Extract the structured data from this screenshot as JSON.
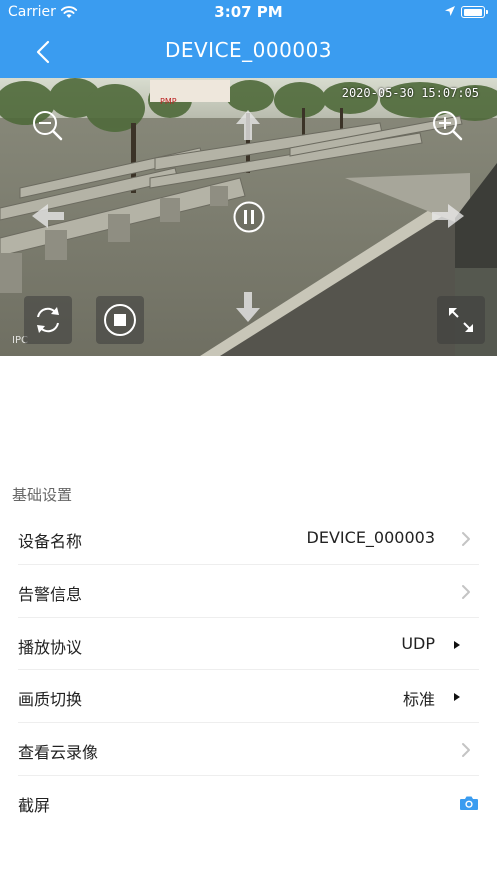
{
  "status_bar": {
    "carrier": "Carrier",
    "time": "3:07 PM",
    "battery_level": 1.0
  },
  "nav": {
    "title": "DEVICE_000003"
  },
  "video": {
    "timestamp": "2020-05-30 15:07:05",
    "source_tag": "IPC"
  },
  "settings": {
    "section_title": "基础设置",
    "rows": [
      {
        "label": "设备名称",
        "value": "DEVICE_000003",
        "accessory": "chevron-right-icon"
      },
      {
        "label": "告警信息",
        "value": "",
        "accessory": "chevron-right-icon"
      },
      {
        "label": "播放协议",
        "value": "UDP",
        "accessory": "triangle-right-icon"
      },
      {
        "label": "画质切换",
        "value": "标准",
        "accessory": "triangle-right-icon"
      },
      {
        "label": "查看云录像",
        "value": "",
        "accessory": "chevron-right-icon"
      },
      {
        "label": "截屏",
        "value": "",
        "accessory": "camera-icon"
      }
    ]
  },
  "colors": {
    "accent": "#3a9cf0",
    "divider": "#eeeeee",
    "section_text": "#666666"
  }
}
